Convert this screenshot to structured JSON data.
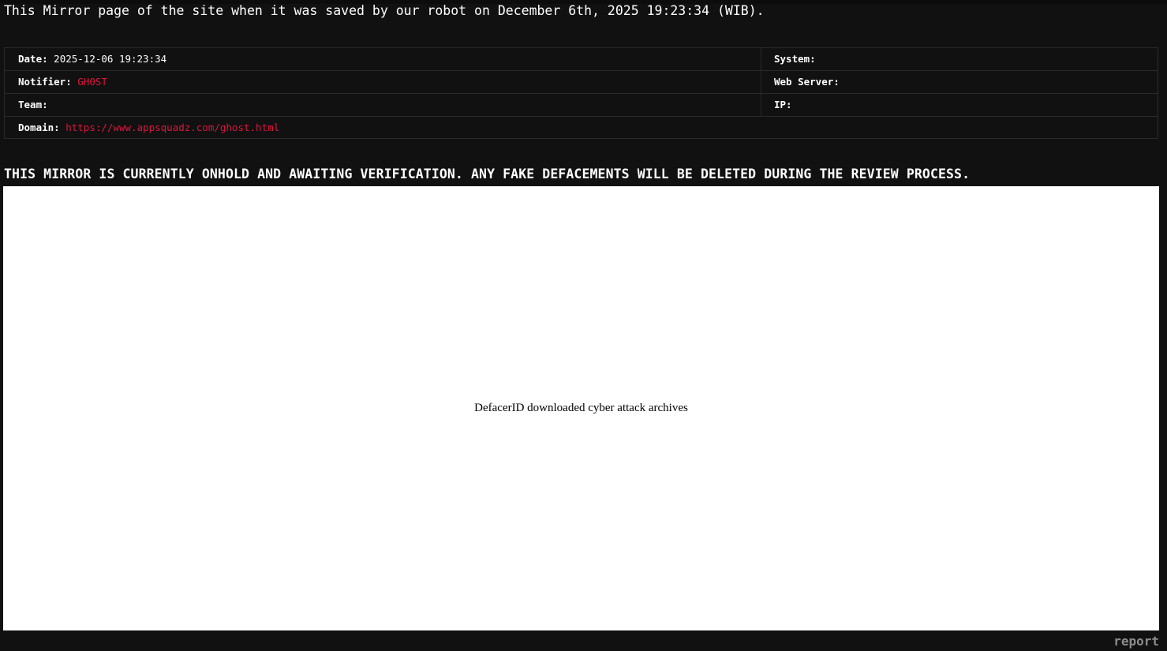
{
  "header": {
    "saved_notice": "This Mirror page of the site when it was saved by our robot on December 6th, 2025 19:23:34 (WIB)."
  },
  "info": {
    "date_label": "Date:",
    "date_value": "2025-12-06 19:23:34",
    "notifier_label": "Notifier:",
    "notifier_value": "GH0ST",
    "team_label": "Team:",
    "team_value": "",
    "domain_label": "Domain:",
    "domain_value": "https://www.appsquadz.com/ghost.html",
    "system_label": "System:",
    "system_value": "",
    "webserver_label": "Web Server:",
    "webserver_value": "",
    "ip_label": "IP:",
    "ip_value": ""
  },
  "notice": {
    "onhold": "THIS MIRROR IS CURRENTLY ONHOLD AND AWAITING VERIFICATION. ANY FAKE DEFACEMENTS WILL BE DELETED DURING THE REVIEW PROCESS."
  },
  "mirror": {
    "content_text": "DefacerID downloaded cyber attack archives"
  },
  "footer": {
    "report_label": "report"
  },
  "colors": {
    "background": "#111111",
    "accent_red": "#d9163f",
    "muted": "#8c8c8c"
  }
}
